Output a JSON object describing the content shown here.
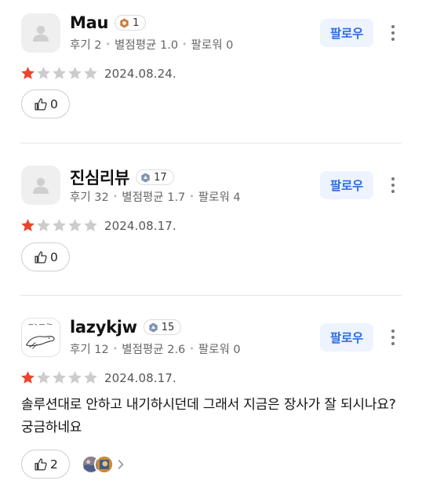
{
  "follow_label": "팔로우",
  "reviews": [
    {
      "name": "Mau",
      "level": "1",
      "stats": {
        "reviews": "후기 2",
        "rating": "별점평균 1.0",
        "followers": "팔로워 0"
      },
      "stars_filled": 1,
      "stars_total": 5,
      "date": "2024.08.24.",
      "likes": "0"
    },
    {
      "name": "진심리뷰",
      "level": "17",
      "stats": {
        "reviews": "후기 32",
        "rating": "별점평균 1.7",
        "followers": "팔로워 4"
      },
      "stars_filled": 1,
      "stars_total": 5,
      "date": "2024.08.17.",
      "likes": "0"
    },
    {
      "name": "lazykjw",
      "level": "15",
      "stats": {
        "reviews": "후기 12",
        "rating": "별점평균 2.6",
        "followers": "팔로워 0"
      },
      "stars_filled": 1,
      "stars_total": 5,
      "date": "2024.08.17.",
      "text": "솔루션대로 안하고 내기하시던데 그래서 지금은 장사가 잘 되시나요? 궁금하네요",
      "likes": "2",
      "has_photos": true
    }
  ],
  "colors": {
    "star_filled": "#e8472e",
    "star_empty": "#cccccc",
    "follow_bg": "#edf3ff",
    "follow_text": "#2f6fe0",
    "level_bronze": "#c97a3a",
    "level_silver": "#7f93b5"
  },
  "icons": {
    "avatar": "default-user-icon",
    "more": "more-vertical-icon",
    "like": "thumbs-up-icon",
    "star": "star-icon",
    "chevron": "chevron-right-icon"
  }
}
